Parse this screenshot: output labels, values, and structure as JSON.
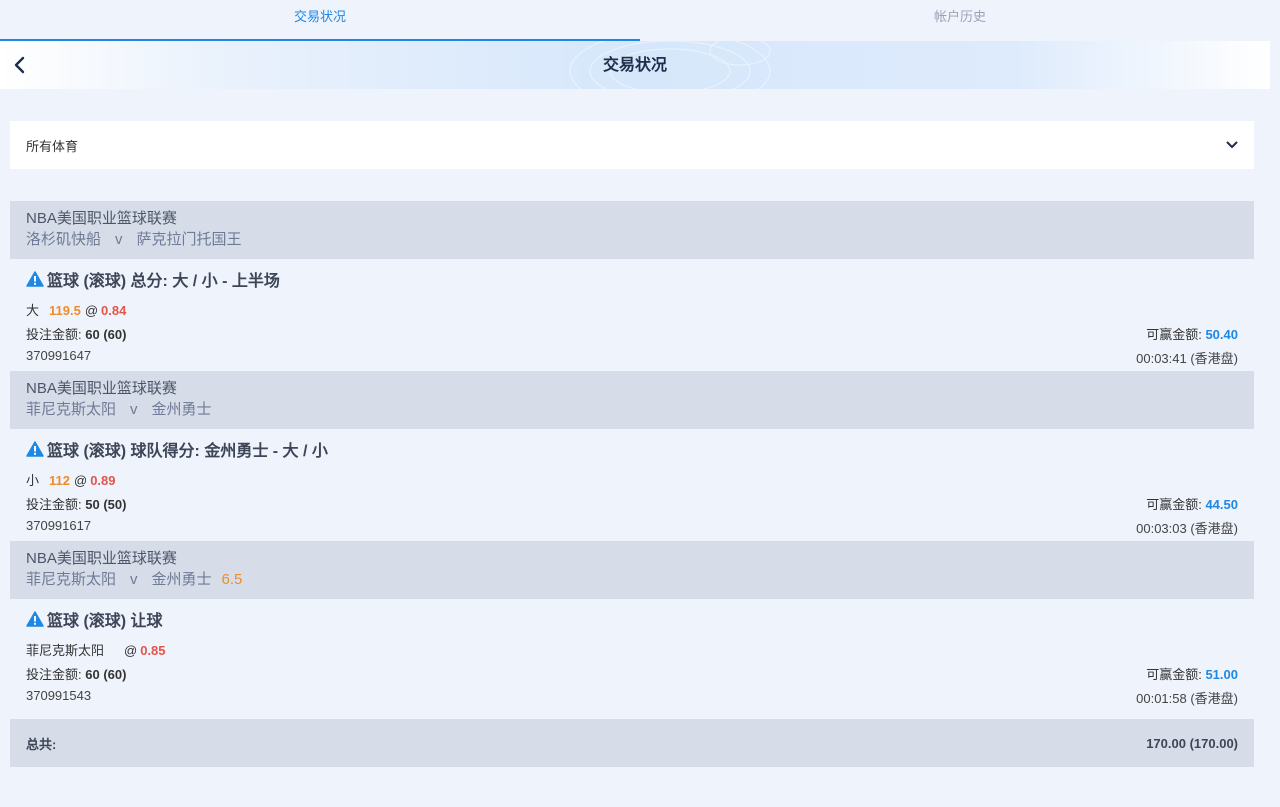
{
  "tabs": [
    {
      "label": "交易状况",
      "active": true
    },
    {
      "label": "帐户历史",
      "active": false
    }
  ],
  "header": {
    "title": "交易状况"
  },
  "filter": {
    "selected": "所有体育"
  },
  "labels": {
    "stake": "投注金额:",
    "to_win": "可赢金额:",
    "total": "总共:"
  },
  "bets": [
    {
      "league": "NBA美国职业篮球联赛",
      "home": "洛杉矶快船",
      "vs": "v",
      "away": "萨克拉门托国王",
      "handicap": "",
      "market": "篮球 (滚球) 总分: 大 / 小 - 上半场",
      "selection": "大",
      "line": "119.5",
      "at": "@",
      "odds": "0.84",
      "stake": "60 (60)",
      "to_win": "50.40",
      "ticket": "370991647",
      "time": "00:03:41 (香港盘)"
    },
    {
      "league": "NBA美国职业篮球联赛",
      "home": "菲尼克斯太阳",
      "vs": "v",
      "away": "金州勇士",
      "handicap": "",
      "market": "篮球 (滚球) 球队得分: 金州勇士 - 大 / 小",
      "selection": "小",
      "line": "112",
      "at": "@",
      "odds": "0.89",
      "stake": "50 (50)",
      "to_win": "44.50",
      "ticket": "370991617",
      "time": "00:03:03 (香港盘)"
    },
    {
      "league": "NBA美国职业篮球联赛",
      "home": "菲尼克斯太阳",
      "vs": "v",
      "away": "金州勇士",
      "handicap": "6.5",
      "market": "篮球 (滚球) 让球",
      "selection": "菲尼克斯太阳",
      "line": "",
      "at": "@",
      "odds": "0.85",
      "stake": "60 (60)",
      "to_win": "51.00",
      "ticket": "370991543",
      "time": "00:01:58 (香港盘)"
    }
  ],
  "total": {
    "value": "170.00 (170.00)"
  },
  "colors": {
    "accent": "#1e88e5",
    "odds": "#e4544b",
    "line": "#f08c2a",
    "header_bg": "#d6dde9"
  },
  "icons": {
    "back": "chevron-left-icon",
    "dropdown": "chevron-down-icon",
    "market": "warning-icon"
  }
}
